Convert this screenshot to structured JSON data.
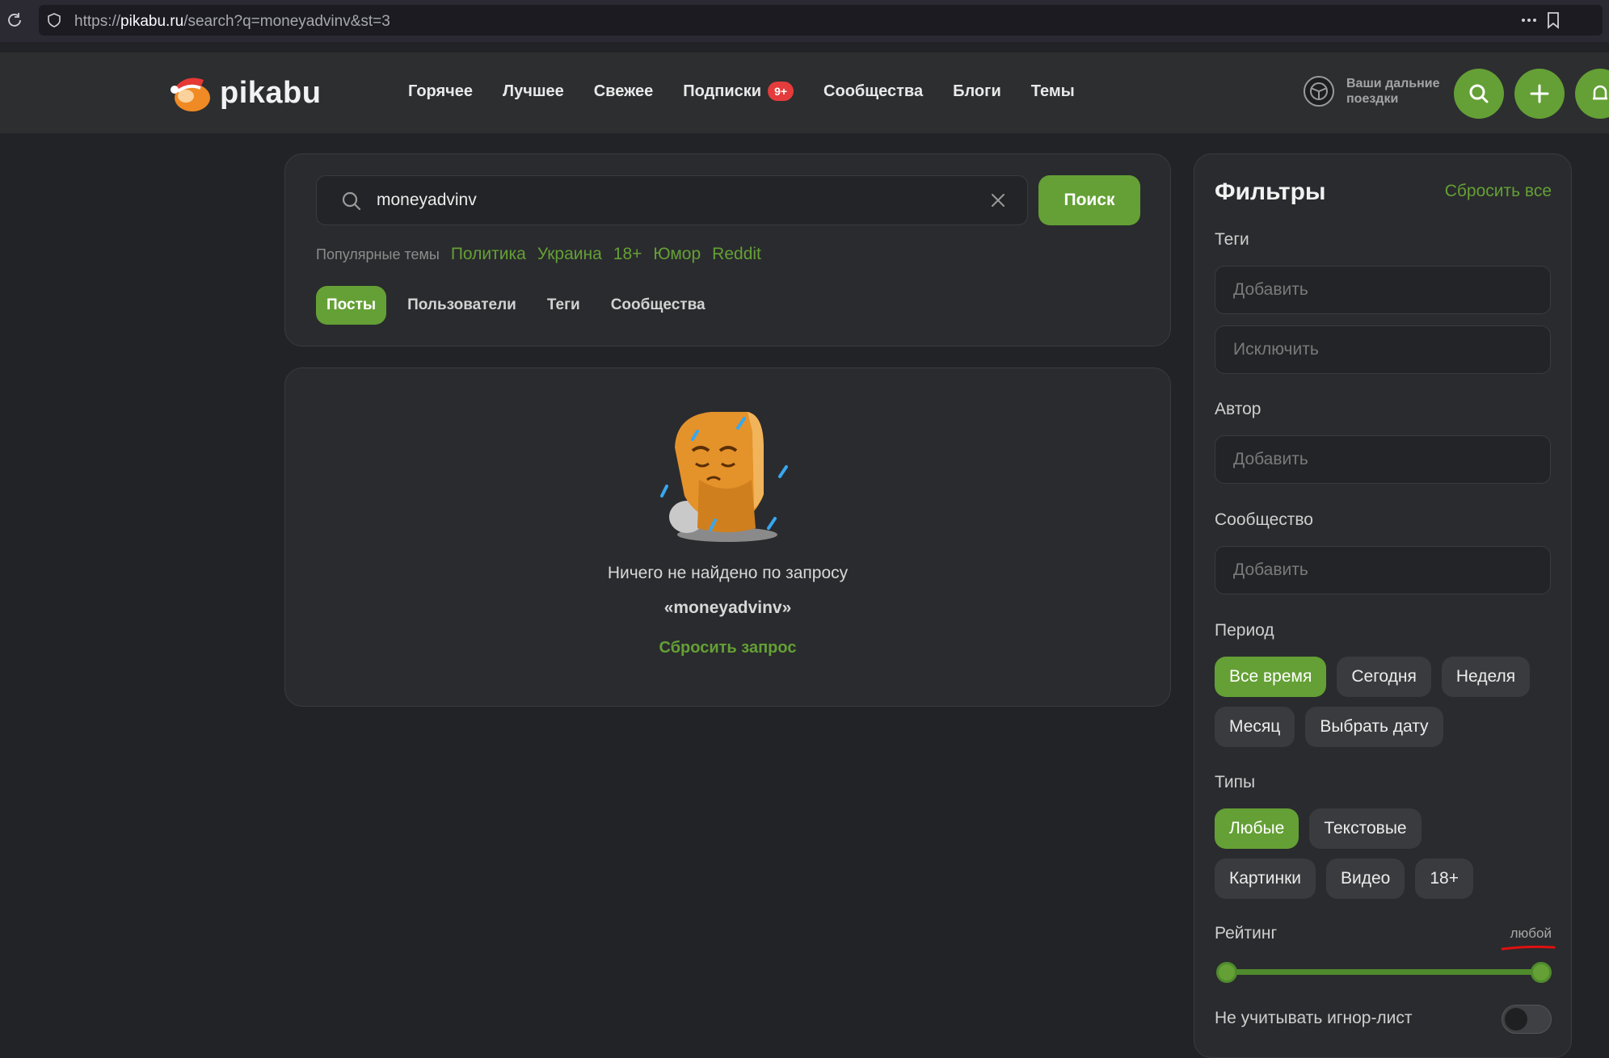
{
  "browser": {
    "url_prefix": "https://",
    "url_host": "pikabu.ru",
    "url_path": "/search?q=moneyadvinv&st=3"
  },
  "header": {
    "logo_text": "pikabu",
    "nav": [
      "Горячее",
      "Лучшее",
      "Свежее",
      "Подписки",
      "Сообщества",
      "Блоги",
      "Темы"
    ],
    "subscriptions_badge": "9+",
    "promo_text": "Ваши дальние поездки"
  },
  "search": {
    "query": "moneyadvinv",
    "button_label": "Поиск",
    "popular_label": "Популярные темы",
    "popular_tags": [
      "Политика",
      "Украина",
      "18+",
      "Юмор",
      "Reddit"
    ],
    "tabs": [
      "Посты",
      "Пользователи",
      "Теги",
      "Сообщества"
    ],
    "active_tab": "Посты"
  },
  "results": {
    "empty_line1": "Ничего не найдено по запросу",
    "empty_line2": "«moneyadvinv»",
    "reset_query": "Сбросить запрос"
  },
  "filters": {
    "title": "Фильтры",
    "reset_all": "Сбросить все",
    "tags_label": "Теги",
    "tags_add_placeholder": "Добавить",
    "tags_exclude_placeholder": "Исключить",
    "author_label": "Автор",
    "author_placeholder": "Добавить",
    "community_label": "Сообщество",
    "community_placeholder": "Добавить",
    "period_label": "Период",
    "period_options": [
      "Все время",
      "Сегодня",
      "Неделя",
      "Месяц",
      "Выбрать дату"
    ],
    "period_selected": "Все время",
    "types_label": "Типы",
    "type_options": [
      "Любые",
      "Текстовые",
      "Картинки",
      "Видео",
      "18+"
    ],
    "type_selected": "Любые",
    "rating_label": "Рейтинг",
    "rating_value": "любой",
    "ignore_label": "Не учитывать игнор-лист",
    "ignore_enabled": false
  },
  "colors": {
    "accent": "#64a035",
    "badge": "#e43c3c",
    "background": "#222326",
    "panel": "#2a2b2e"
  }
}
